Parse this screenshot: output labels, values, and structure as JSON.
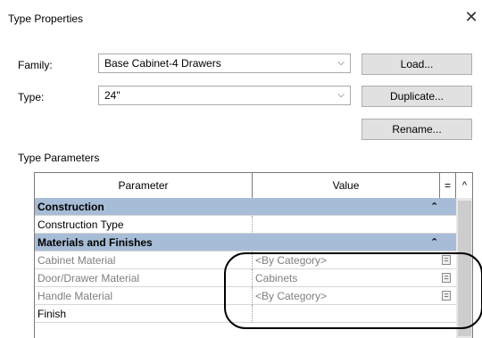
{
  "dialog": {
    "title": "Type Properties",
    "close_glyph": "✕"
  },
  "family": {
    "label": "Family:",
    "value": "Base Cabinet-4 Drawers"
  },
  "type": {
    "label": "Type:",
    "value": "24\""
  },
  "buttons": {
    "load": "Load...",
    "duplicate": "Duplicate...",
    "rename": "Rename..."
  },
  "type_parameters": {
    "label": "Type Parameters",
    "columns": {
      "parameter": "Parameter",
      "value": "Value",
      "eq": "="
    },
    "scroll_up_glyph": "^",
    "rows": [
      {
        "parameter": "Construction",
        "value": "",
        "group": true,
        "marker": "⌃"
      },
      {
        "parameter": "Construction Type",
        "value": ""
      },
      {
        "parameter": "Materials and Finishes",
        "value": "",
        "group": true,
        "marker": "⌃"
      },
      {
        "parameter": "Cabinet Material",
        "value": "<By Category>",
        "gray": true,
        "eq": "="
      },
      {
        "parameter": "Door/Drawer Material",
        "value": "Cabinets",
        "gray": true,
        "eq": "="
      },
      {
        "parameter": "Handle Material",
        "value": "<By Category>",
        "gray": true,
        "eq": "="
      },
      {
        "parameter": "Finish",
        "value": ""
      }
    ]
  },
  "icons": {
    "combo_chevron": "chevron-down-icon",
    "close": "close-icon"
  },
  "colors": {
    "group_header": "#a7bcd6",
    "disabled_text": "#7f7f7f",
    "button_face": "#e1e1e1",
    "callout": "#000000"
  }
}
